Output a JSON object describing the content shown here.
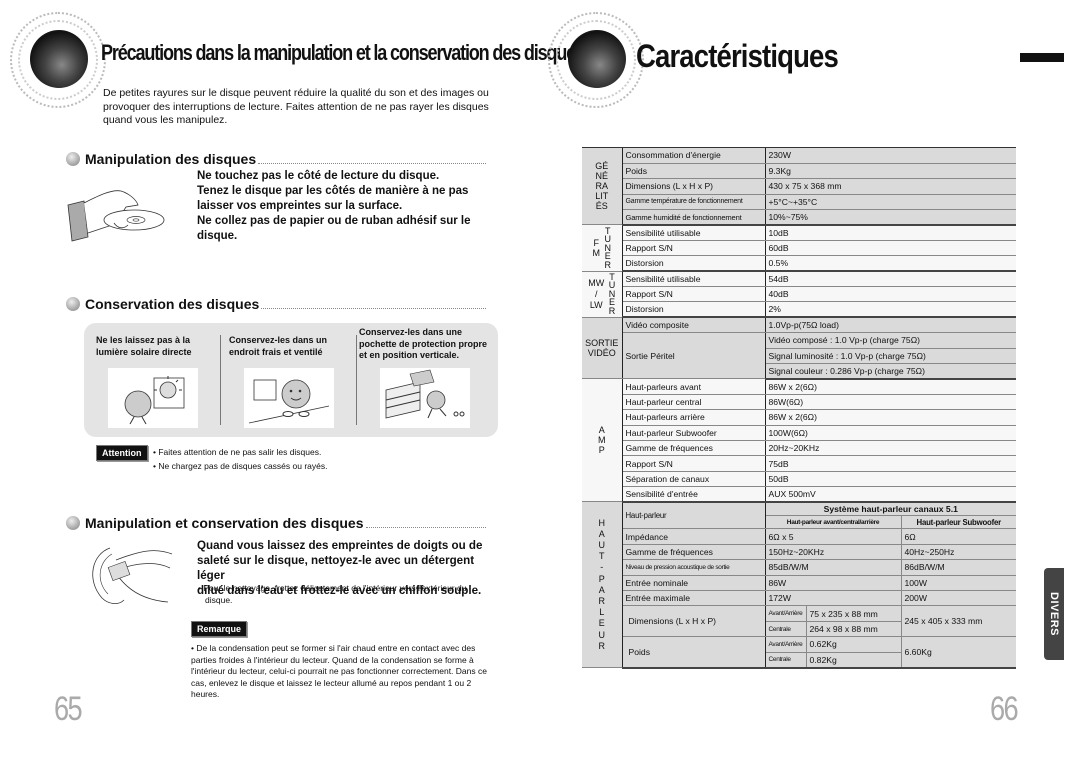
{
  "left_page": {
    "title": "Précautions dans la manipulation et la conservation des disques",
    "intro": "De petites rayures sur le disque peuvent réduire la qualité du son et des images ou provoquer des interruptions de lecture. Faites attention de ne pas rayer les disques quand vous les manipulez.",
    "section_handling": {
      "heading": "Manipulation des disques",
      "lines": [
        "Ne touchez pas le côté de lecture du disque.",
        "Tenez le disque par les côtés de manière à ne pas",
        "laisser vos empreintes sur la surface.",
        "Ne collez pas de papier ou de ruban adhésif sur le",
        "disque."
      ]
    },
    "section_storage": {
      "heading": "Conservation des disques",
      "columns": [
        {
          "caption_1": "Ne les laissez pas à la",
          "caption_2": "lumière solaire directe",
          "caption_3": ""
        },
        {
          "caption_1": "Conservez-les dans un",
          "caption_2": "endroit frais et ventilé",
          "caption_3": ""
        },
        {
          "caption_1": "Conservez-les dans une",
          "caption_2": "pochette de protection propre",
          "caption_3": "et en position verticale."
        }
      ],
      "attention_label": "Attention",
      "attention_items": [
        "• Faites attention de ne pas salir les disques.",
        "• Ne chargez pas de disques cassés ou rayés."
      ]
    },
    "section_cleaning": {
      "heading": "Manipulation et conservation des disques",
      "lines": [
        "Quand vous laissez des empreintes de doigts ou de",
        "saleté sur le disque, nettoyez-le avec un détergent léger",
        "dilué dans l'eau et frottez-le avec un chiffon souple."
      ],
      "tip_1": "• Pour le nettoyage, frottez délicatement de l'intérieur vers l'extérieur du",
      "tip_2": "disque.",
      "remark_label": "Remarque",
      "remark_text": "• De la condensation peut se former si l'air chaud entre en contact avec des parties froides à l'intérieur du lecteur.  Quand de la condensation se forme à l'intérieur du lecteur, celui-ci pourrait ne pas fonctionner correctement.  Dans ce cas, enlevez le disque et laissez le lecteur allumé au repos pendant 1 ou 2 heures."
    },
    "page_number": "65"
  },
  "right_page": {
    "title": "Caractéristiques",
    "side_tab": "DIVERS",
    "page_number": "66",
    "general": {
      "group": [
        "GÉ",
        "NÉ",
        "RA",
        "LIT",
        "ÉS"
      ],
      "rows": [
        {
          "label": "Consommation d'énergie",
          "value": "230W"
        },
        {
          "label": "Poids",
          "value": "9.3Kg"
        },
        {
          "label": "Dimensions (L x H x P)",
          "value": "430 x 75 x 368 mm"
        },
        {
          "label": "Gamme température de fonctionnement",
          "value": "+5°C~+35°C"
        },
        {
          "label": "Gamme humidité de fonctionnement",
          "value": "10%~75%"
        }
      ]
    },
    "tuner_fm": {
      "group": "F\nM",
      "side": "TUNER",
      "rows": [
        {
          "label": "Sensibilité utilisable",
          "value": "10dB"
        },
        {
          "label": "Rapport S/N",
          "value": "60dB"
        },
        {
          "label": "Distorsion",
          "value": "0.5%"
        }
      ]
    },
    "tuner_mwlw": {
      "group_1": "MW",
      "group_2": "/",
      "group_3": "LW",
      "side": "TUNER",
      "rows": [
        {
          "label": "Sensibilité utilisable",
          "value": "54dB"
        },
        {
          "label": "Rapport S/N",
          "value": "40dB"
        },
        {
          "label": "Distorsion",
          "value": "2%"
        }
      ]
    },
    "video": {
      "group_1": "SORTIE",
      "group_2": "VIDÉO",
      "composite_label": "Vidéo composite",
      "composite_value": "1.0Vp-p(75Ω load)",
      "scart_label": "Sortie Péritel",
      "scart_values": [
        "Vidéo composé : 1.0 Vp-p (charge 75Ω)",
        "Signal luminosité : 1.0 Vp-p (charge 75Ω)",
        "Signal couleur : 0.286 Vp-p (charge 75Ω)"
      ]
    },
    "amp": {
      "group": [
        "A",
        "M",
        "P"
      ],
      "rows": [
        {
          "label": "Haut-parleurs avant",
          "value": "86W x 2(6Ω)"
        },
        {
          "label": "Haut-parleur central",
          "value": "86W(6Ω)"
        },
        {
          "label": "Haut-parleurs arrière",
          "value": "86W x 2(6Ω)"
        },
        {
          "label": "Haut-parleur Subwoofer",
          "value": "100W(6Ω)"
        },
        {
          "label": "Gamme de fréquences",
          "value": "20Hz~20KHz"
        },
        {
          "label": "Rapport S/N",
          "value": "75dB"
        },
        {
          "label": "Séparation de canaux",
          "value": "50dB"
        },
        {
          "label": "Sensibilité d'entrée",
          "value": "AUX 500mV"
        }
      ]
    },
    "speaker": {
      "group": [
        "H",
        "A",
        "U",
        "T",
        "-",
        "P",
        "A",
        "R",
        "L",
        "E",
        "U",
        "R"
      ],
      "label": "Haut-parleur",
      "system_header": "Système haut-parleur canaux 5.1",
      "col_front": "Haut-parleur avant/central/arrière",
      "col_sub": "Haut-parleur Subwoofer",
      "rows": [
        {
          "label": "Impédance",
          "front": "6Ω x 5",
          "sub": "6Ω"
        },
        {
          "label": "Gamme de fréquences",
          "front": "150Hz~20KHz",
          "sub": "40Hz~250Hz"
        },
        {
          "label": "Niveau de pression acoustique de sortie",
          "front": "85dB/W/M",
          "sub": "86dB/W/M"
        },
        {
          "label": "Entrée nominale",
          "front": "86W",
          "sub": "100W"
        },
        {
          "label": "Entrée maximale",
          "front": "172W",
          "sub": "200W"
        }
      ],
      "dimensions": {
        "label": "Dimensions (L x H x P)",
        "front_rear_label": "Avant/Arrière",
        "front_rear_value": "75 x 235 x 88 mm",
        "center_label": "Centrale",
        "center_value": "264 x 98 x 88 mm",
        "sub": "245 x 405 x 333 mm"
      },
      "weight": {
        "label": "Poids",
        "front_rear_label": "Avant/Arrière",
        "front_rear_value": "0.62Kg",
        "center_label": "Centrale",
        "center_value": "0.82Kg",
        "sub": "6.60Kg"
      }
    }
  }
}
